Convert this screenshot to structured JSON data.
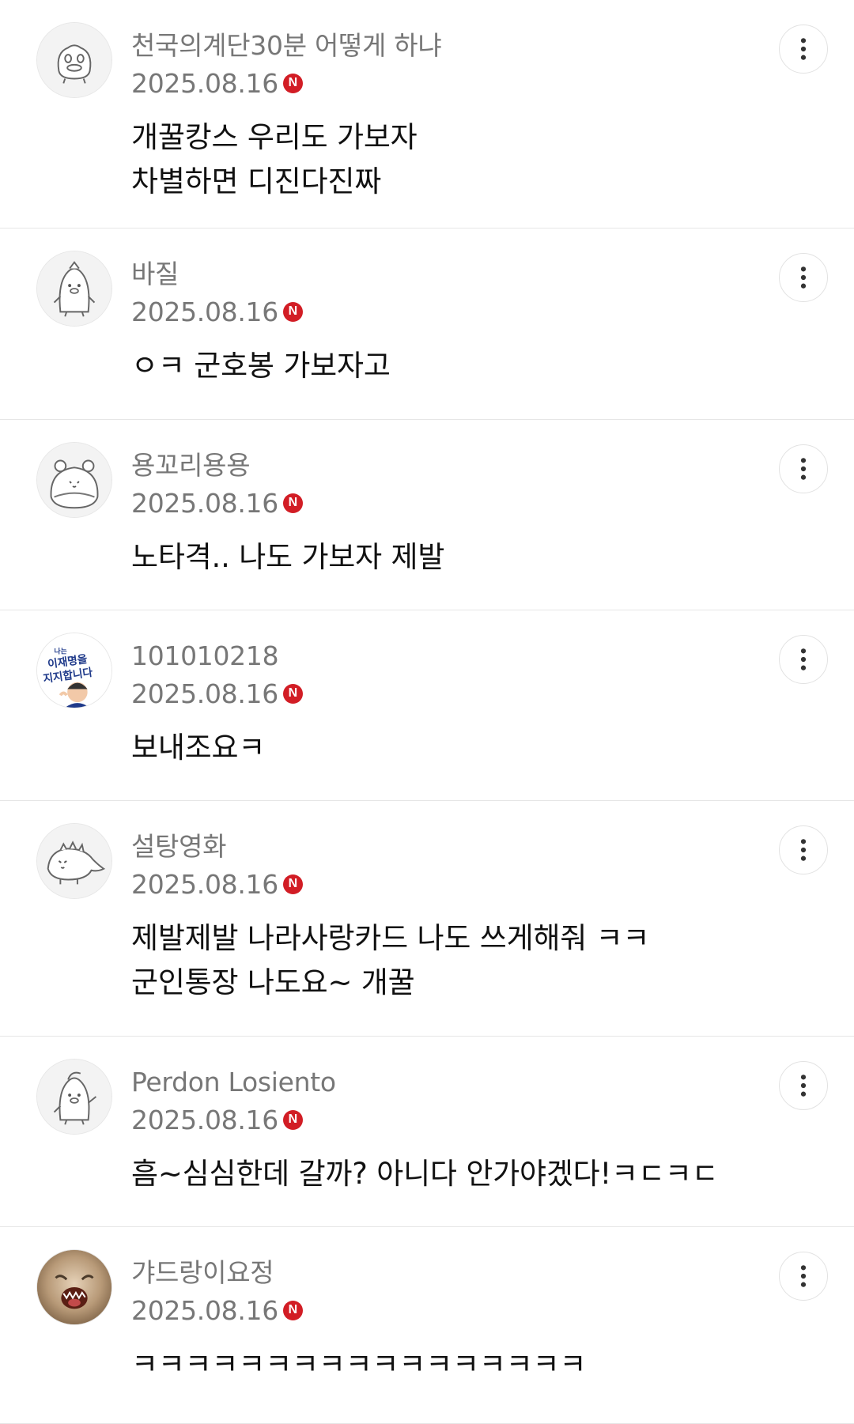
{
  "comments": [
    {
      "author": "천국의계단30분 어떻게 하냐",
      "date": "2025.08.16",
      "badge": "N",
      "lines": [
        "개꿀캉스 우리도 가보자",
        "차별하면 디진다진짜"
      ],
      "avatar_icon": "duck-doodle-avatar-icon"
    },
    {
      "author": "바질",
      "date": "2025.08.16",
      "badge": "N",
      "lines": [
        "ㅇㅋ 군호봉 가보자고"
      ],
      "avatar_icon": "penguin-doodle-avatar-icon"
    },
    {
      "author": "용꼬리용용",
      "date": "2025.08.16",
      "badge": "N",
      "lines": [
        "노타격.. 나도 가보자 제발"
      ],
      "avatar_icon": "bear-doodle-avatar-icon"
    },
    {
      "author": "101010218",
      "date": "2025.08.16",
      "badge": "N",
      "lines": [
        "보내조요ㅋ"
      ],
      "avatar_icon": "campaign-sticker-avatar-icon",
      "avatar_text": [
        "나는",
        "이재명을",
        "지지합니다"
      ],
      "avatar_colors": {
        "navy": "#1f3a8a",
        "skin": "#f2c9a8"
      }
    },
    {
      "author": "설탕영화",
      "date": "2025.08.16",
      "badge": "N",
      "lines": [
        "제발제발 나라사랑카드 나도 쓰게해줘 ㅋㅋ",
        "군인통장 나도요~ 개꿀"
      ],
      "avatar_icon": "dinosaur-doodle-avatar-icon"
    },
    {
      "author": "Perdon Losiento",
      "date": "2025.08.16",
      "badge": "N",
      "lines": [
        "흠~심심한데 갈까? 아니다 안가야겠다!ㅋㄷㅋㄷ"
      ],
      "avatar_icon": "penguin-waving-avatar-icon"
    },
    {
      "author": "갸드랑이요정",
      "date": "2025.08.16",
      "badge": "N",
      "lines": [
        "ㅋㅋㅋㅋㅋㅋㅋㅋㅋㅋㅋㅋㅋㅋㅋㅋㅋ"
      ],
      "avatar_icon": "screaming-cat-photo-avatar-icon",
      "avatar_colors": {
        "fur": "#b89a78",
        "mouth": "#5a1f14"
      }
    }
  ],
  "more_icon": "kebab-menu-icon",
  "colors": {
    "badge": "#d21d25",
    "meta_text": "#777777",
    "divider": "#e6e6e6"
  }
}
